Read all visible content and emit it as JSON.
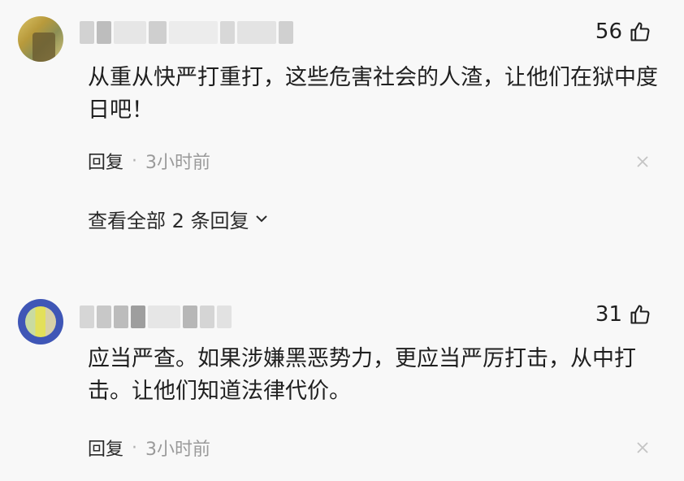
{
  "comments": [
    {
      "likes": "56",
      "text": "从重从快严打重打，这些危害社会的人渣，让他们在狱中度日吧！",
      "reply_label": "回复",
      "separator": "·",
      "time": "3小时前",
      "view_replies": "查看全部 2 条回复"
    },
    {
      "likes": "31",
      "text": "应当严查。如果涉嫌黑恶势力，更应当严厉打击，从中打击。让他们知道法律代价。",
      "reply_label": "回复",
      "separator": "·",
      "time": "3小时前"
    }
  ],
  "icons": {
    "like": "thumbs-up-icon",
    "close": "close-icon",
    "chevron": "chevron-down-icon"
  },
  "colors": {
    "background": "#f8f8f8",
    "text": "#1f1f1f",
    "muted": "#9a9a9a"
  }
}
